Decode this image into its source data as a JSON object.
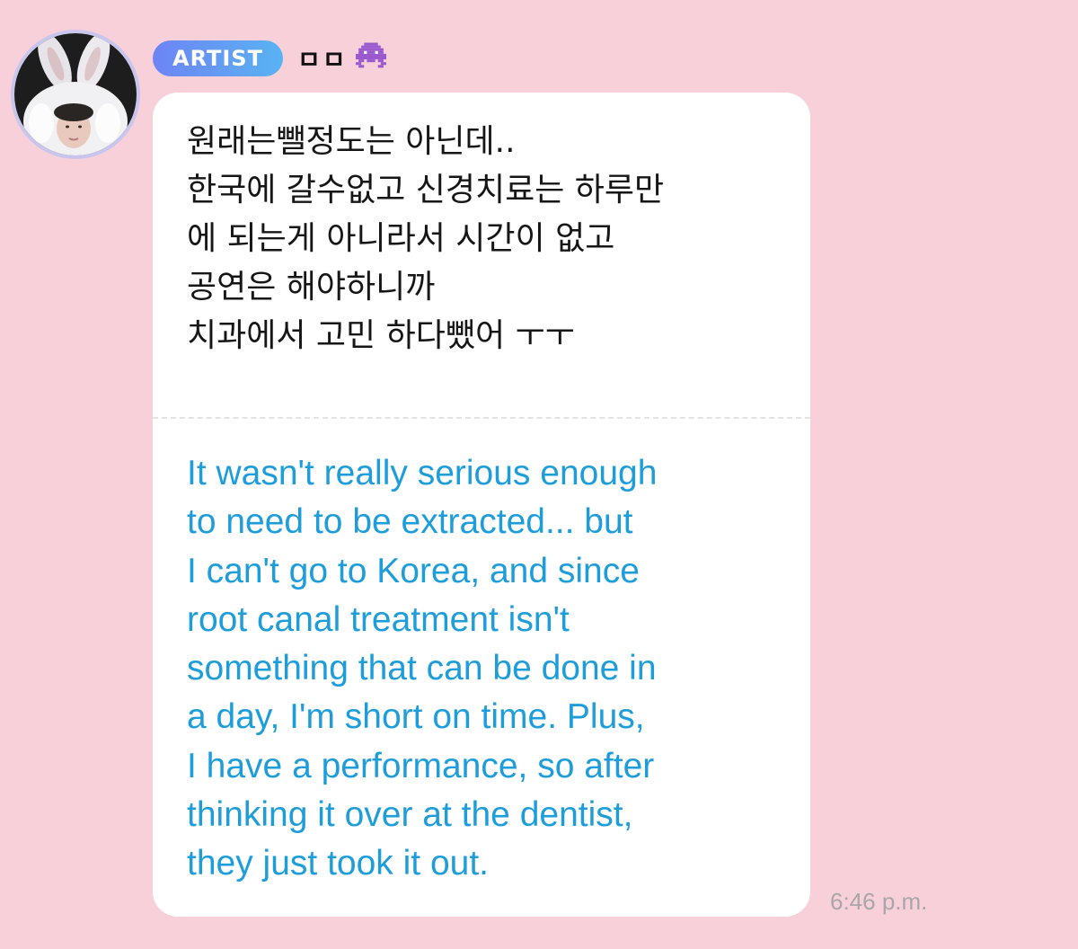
{
  "message": {
    "sender": {
      "badge": "ARTIST",
      "name": "ㅁㅁ",
      "emoji": "alien-monster-icon",
      "avatar": "profile-photo-bunny-hat"
    },
    "korean_text": "원래는뺄정도는 아닌데..\n한국에 갈수없고 신경치료는 하루만\n에 되는게 아니라서 시간이 없고\n공연은 해야하니까\n치과에서 고민 하다뺐어 ㅜㅜ",
    "translation_text": "It wasn't really serious enough\nto need to be extracted... but\nI can't go to Korea, and since\nroot canal treatment isn't\nsomething that can be done in\na day, I'm short on time. Plus,\nI have a performance, so after\nthinking it over at the dentist,\nthey just took it out.",
    "timestamp": "6:46 p.m."
  },
  "colors": {
    "background": "#f8d0da",
    "bubble": "#ffffff",
    "translation": "#1e9ddb",
    "badge_start": "#6d84f4",
    "badge_end": "#59b3f2",
    "timestamp": "#a9a6a8",
    "avatar_ring": "#c9c6ee",
    "emoji": "#9b59d0"
  }
}
